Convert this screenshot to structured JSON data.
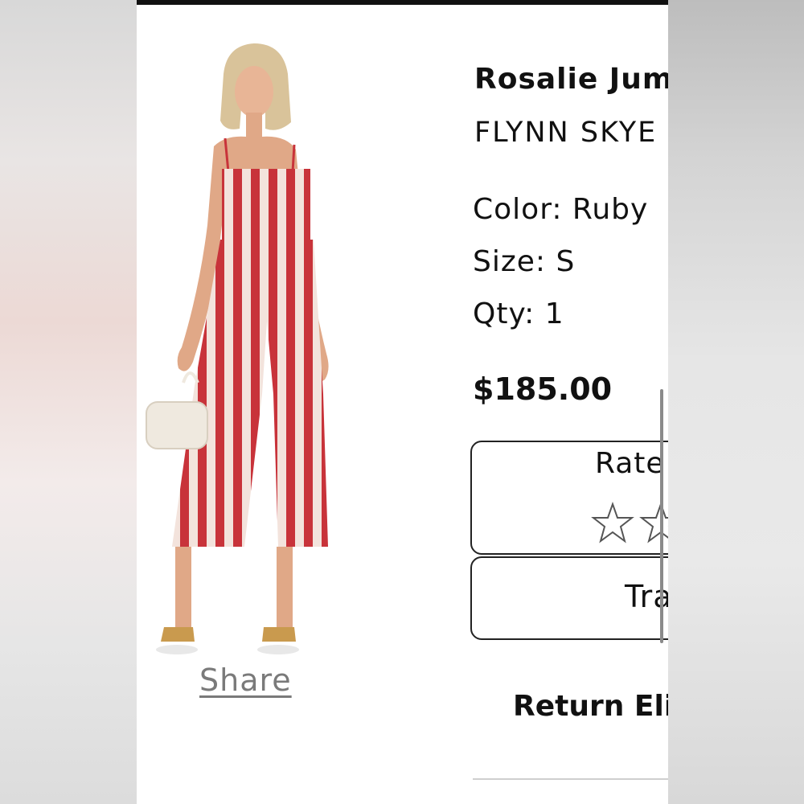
{
  "product": {
    "name": "Rosalie Jum",
    "brand": "FLYNN SKYE",
    "color_line": "Color: Ruby",
    "size_line": "Size: S",
    "qty_line": "Qty: 1",
    "price": "$185.00",
    "image_icon": "striped-jumpsuit-photo"
  },
  "actions": {
    "share_label": "Share",
    "rate_label": "Rate",
    "track_label": "Tra",
    "star_icon": "star-outline-icon"
  },
  "returns": {
    "label": "Return Elig"
  },
  "colors": {
    "stripe_red": "#c8333a",
    "stripe_cream": "#f3e3dc",
    "text": "#111111",
    "link_gray": "#7a7a7a"
  }
}
